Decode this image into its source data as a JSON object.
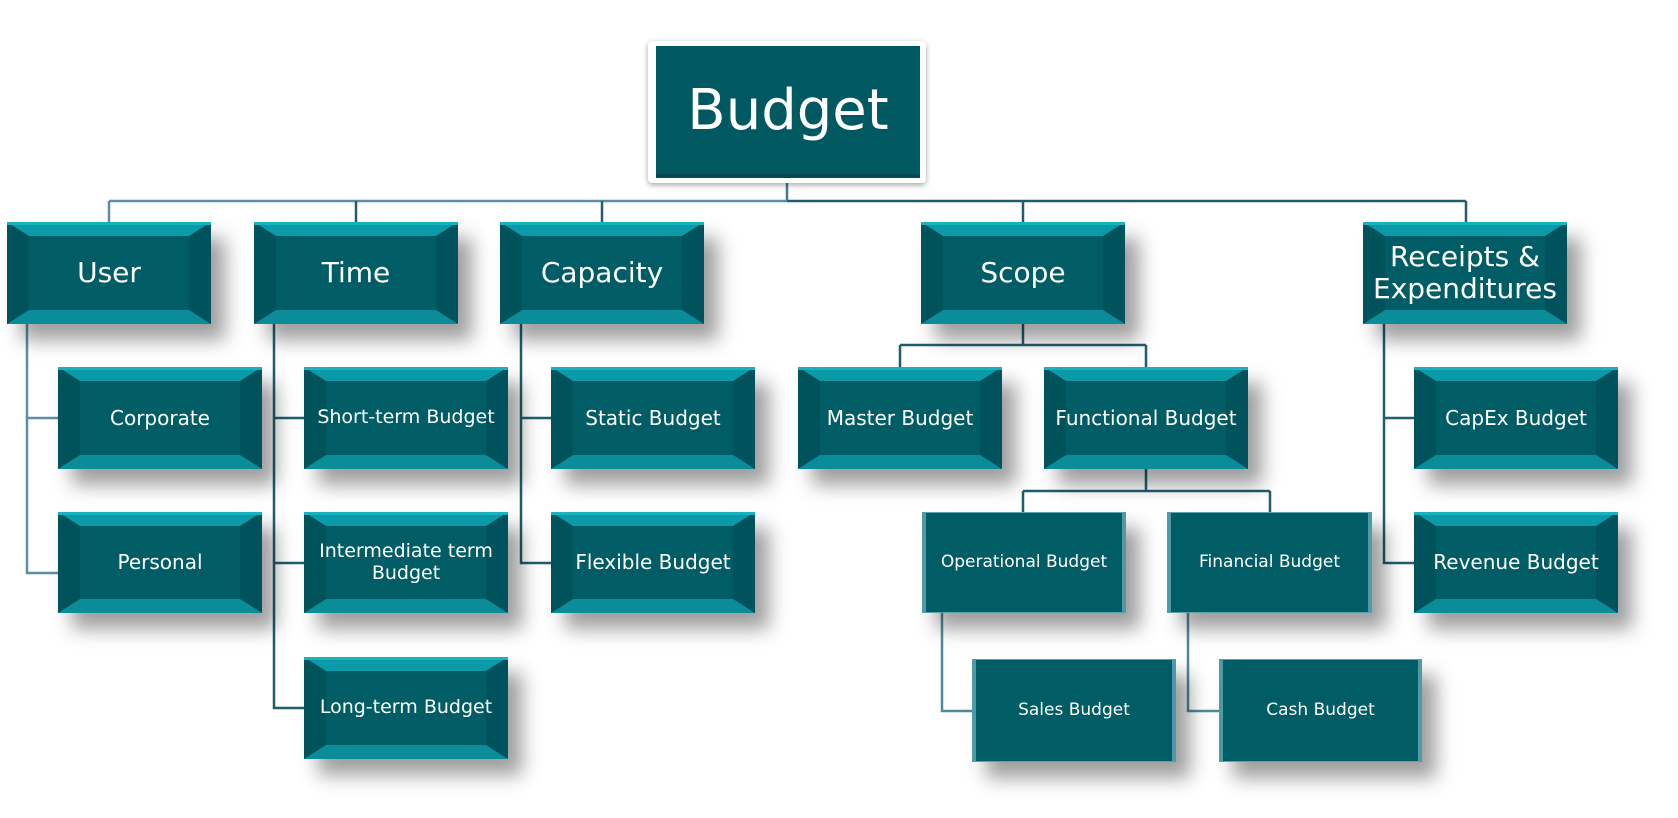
{
  "diagram": {
    "type": "org-chart",
    "colors": {
      "box": "#005d66",
      "bevel": "#0a9aa8",
      "connector": "#1f5f6b",
      "connector_light": "#5b8fa6"
    },
    "root": "Budget",
    "categories": [
      {
        "label": "User",
        "children": [
          "Corporate",
          "Personal"
        ]
      },
      {
        "label": "Time",
        "children": [
          "Short-term Budget",
          "Intermediate term Budget",
          "Long-term Budget"
        ]
      },
      {
        "label": "Capacity",
        "children": [
          "Static Budget",
          "Flexible Budget"
        ]
      },
      {
        "label": "Scope",
        "children": [
          {
            "label": "Master Budget"
          },
          {
            "label": "Functional Budget",
            "children": [
              {
                "label": "Operational Budget",
                "children": [
                  "Sales Budget"
                ]
              },
              {
                "label": "Financial Budget",
                "children": [
                  "Cash Budget"
                ]
              }
            ]
          }
        ]
      },
      {
        "label": "Receipts & Expenditures",
        "children": [
          "CapEx Budget",
          "Revenue Budget"
        ]
      }
    ]
  },
  "nodes": {
    "root": "Budget",
    "user": "User",
    "time": "Time",
    "capacity": "Capacity",
    "scope": "Scope",
    "receipts": "Receipts & Expenditures",
    "corporate": "Corporate",
    "personal": "Personal",
    "short_term": "Short-term Budget",
    "intermediate": "Intermediate term Budget",
    "long_term": "Long-term Budget",
    "static": "Static Budget",
    "flexible": "Flexible Budget",
    "master": "Master Budget",
    "functional": "Functional Budget",
    "operational": "Operational Budget",
    "financial": "Financial Budget",
    "sales": "Sales Budget",
    "cash": "Cash Budget",
    "capex": "CapEx Budget",
    "revenue": "Revenue Budget"
  }
}
